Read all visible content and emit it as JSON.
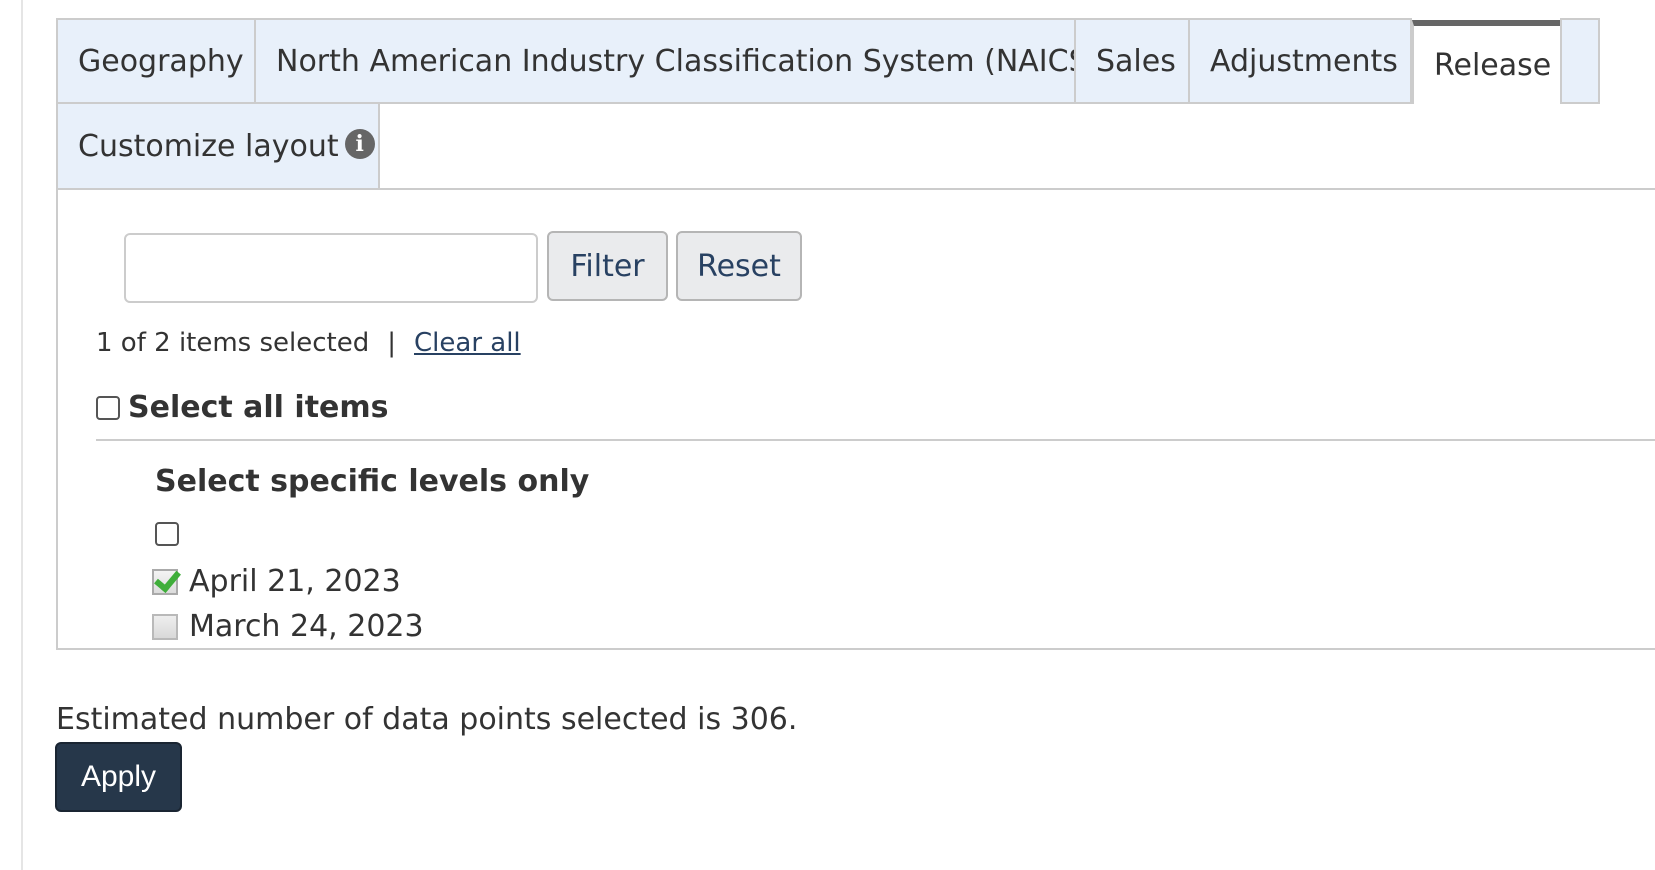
{
  "tabs": [
    {
      "label": "Geography",
      "active": false
    },
    {
      "label": "North American Industry Classification System (NAICS)",
      "active": false
    },
    {
      "label": "Sales",
      "active": false
    },
    {
      "label": "Adjustments",
      "active": false
    },
    {
      "label": "Release",
      "active": true
    },
    {
      "label": "Customize layout",
      "active": false,
      "icon": "info-icon"
    }
  ],
  "filter": {
    "search_value": "",
    "filter_label": "Filter",
    "reset_label": "Reset"
  },
  "selection": {
    "count_text": "1 of 2 items selected",
    "separator": "|",
    "clear_all_label": "Clear all",
    "select_all_label": "Select all items",
    "select_all_checked": false
  },
  "levels": {
    "heading": "Select specific levels only",
    "level_checked": false
  },
  "items": [
    {
      "label": "April 21, 2023",
      "checked": true
    },
    {
      "label": "March 24, 2023",
      "checked": false
    }
  ],
  "estimate_text": "Estimated number of data points selected is 306.",
  "apply_label": "Apply",
  "colors": {
    "tab_bg": "#e8f0fa",
    "active_tab_top": "#666666",
    "apply_bg": "#26374a",
    "link": "#284162",
    "check_green": "#3fae3a"
  }
}
